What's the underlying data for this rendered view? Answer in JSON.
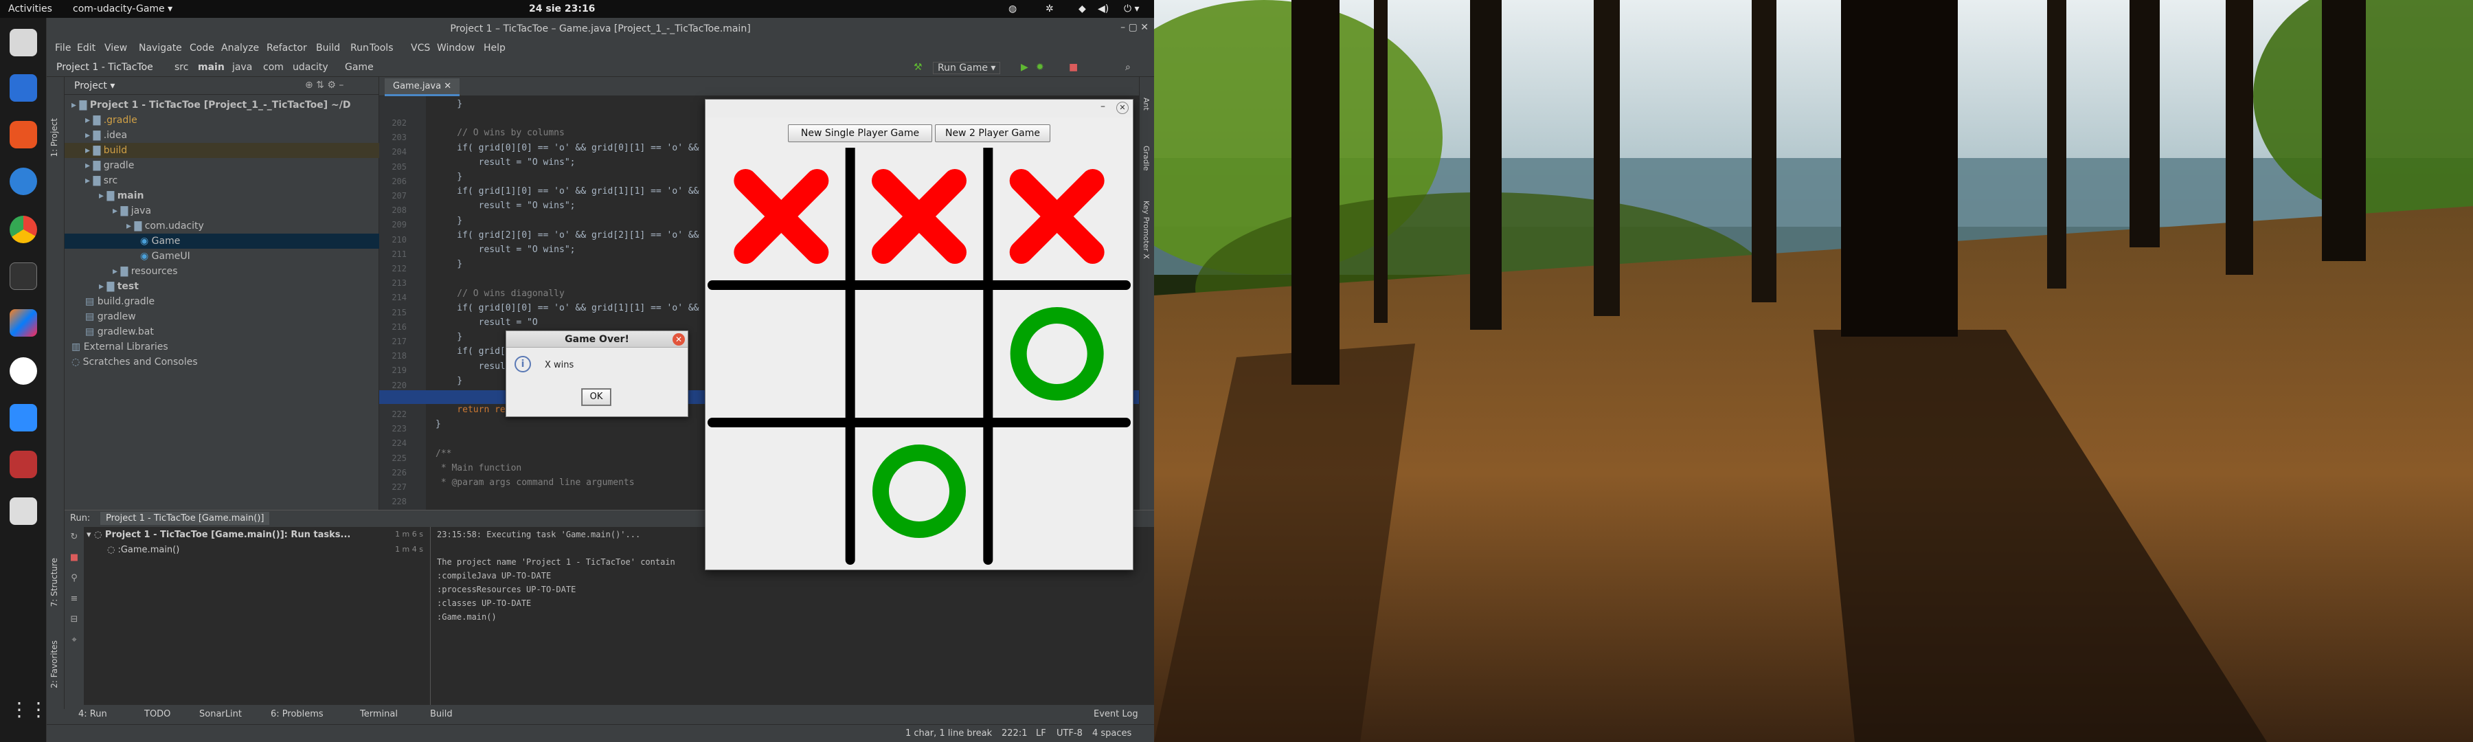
{
  "topbar": {
    "activities": "Activities",
    "app": "com-udacity-Game ▾",
    "datetime": "24 sie  23:16"
  },
  "ide": {
    "title": "Project 1 – TicTacToe – Game.java [Project_1_-_TicTacToe.main]",
    "menu": [
      "File",
      "Edit",
      "View",
      "Navigate",
      "Code",
      "Analyze",
      "Refactor",
      "Build",
      "Run",
      "Tools",
      "VCS",
      "Window",
      "Help"
    ],
    "breadcrumb": [
      "Project 1 - TicTacToe",
      "src",
      "main",
      "java",
      "com",
      "udacity",
      "Game"
    ],
    "run_config": "Run Game ▾",
    "project_panel": {
      "label": "Project ▾",
      "tree": [
        {
          "t": "Project 1 - TicTacToe [Project_1_-_TicTacToe] ~/D",
          "d": 0
        },
        {
          "t": ".gradle",
          "d": 1
        },
        {
          "t": ".idea",
          "d": 1
        },
        {
          "t": "build",
          "d": 1
        },
        {
          "t": "gradle",
          "d": 1
        },
        {
          "t": "src",
          "d": 1
        },
        {
          "t": "main",
          "d": 2
        },
        {
          "t": "java",
          "d": 3
        },
        {
          "t": "com.udacity",
          "d": 4
        },
        {
          "t": "Game",
          "d": 5
        },
        {
          "t": "GameUI",
          "d": 5
        },
        {
          "t": "resources",
          "d": 3
        },
        {
          "t": "test",
          "d": 2
        },
        {
          "t": "build.gradle",
          "d": 1
        },
        {
          "t": "gradlew",
          "d": 1
        },
        {
          "t": "gradlew.bat",
          "d": 1
        },
        {
          "t": "External Libraries",
          "d": 0
        },
        {
          "t": "Scratches and Consoles",
          "d": 0
        }
      ]
    },
    "editor_tab": "Game.java",
    "code_lines": [
      {
        "n": "202",
        "c": "    }"
      },
      {
        "n": "203",
        "c": ""
      },
      {
        "n": "204",
        "c": "    // O wins by columns"
      },
      {
        "n": "205",
        "c": "    if( grid[0][0] == 'o' && grid[0][1] == 'o' && grid[0"
      },
      {
        "n": "206",
        "c": "        result = \"O wins\";"
      },
      {
        "n": "207",
        "c": "    }"
      },
      {
        "n": "208",
        "c": "    if( grid[1][0] == 'o' && grid[1][1] == 'o' && grid[1"
      },
      {
        "n": "209",
        "c": "        result = \"O wins\";"
      },
      {
        "n": "210",
        "c": "    }"
      },
      {
        "n": "211",
        "c": "    if( grid[2][0] == 'o' && grid[2][1] == 'o' && grid[2"
      },
      {
        "n": "212",
        "c": "        result = \"O wins\";"
      },
      {
        "n": "213",
        "c": "    }"
      },
      {
        "n": "214",
        "c": ""
      },
      {
        "n": "215",
        "c": "    // O wins diagonally"
      },
      {
        "n": "216",
        "c": "    if( grid[0][0] == 'o' && grid[1][1] == 'o' && grid[2"
      },
      {
        "n": "217",
        "c": "        result = \"O"
      },
      {
        "n": "218",
        "c": "    }"
      },
      {
        "n": "219",
        "c": "    if( grid[2][0]"
      },
      {
        "n": "220",
        "c": "        result = \"O"
      },
      {
        "n": "221",
        "c": "    }"
      },
      {
        "n": "222",
        "c": ""
      },
      {
        "n": "223",
        "c": "    return result;"
      },
      {
        "n": "224",
        "c": "}"
      },
      {
        "n": "225",
        "c": ""
      },
      {
        "n": "226",
        "c": "/**"
      },
      {
        "n": "227",
        "c": " * Main function"
      },
      {
        "n": "228",
        "c": " * @param args command line arguments"
      }
    ],
    "run_panel": {
      "label": "Run:",
      "tab": "Project 1 - TicTacToe [Game.main()]",
      "tree": [
        {
          "t": "Project 1 - TicTacToe [Game.main()]: Run tasks...",
          "time": "1 m 6 s"
        },
        {
          "t": ":Game.main()",
          "time": "1 m 4 s"
        }
      ],
      "console": [
        "23:15:58: Executing task 'Game.main()'...",
        "",
        "The project name 'Project 1 - TicTacToe' contain",
        ":compileJava UP-TO-DATE",
        ":processResources UP-TO-DATE",
        ":classes UP-TO-DATE",
        ":Game.main()"
      ]
    },
    "bottom_tools": [
      "4: Run",
      "TODO",
      "SonarLint",
      "6: Problems",
      "Terminal",
      "Build"
    ],
    "event_log": "Event Log",
    "status": {
      "selection": "1 char, 1 line break",
      "position": "222:1",
      "line_sep": "LF",
      "encoding": "UTF-8",
      "indent": "4 spaces"
    },
    "left_strip": [
      "1: Project",
      "7: Structure",
      "2: Favorites"
    ],
    "right_strip": [
      "Ant",
      "Gradle",
      "Key Promoter X"
    ]
  },
  "dialog": {
    "title": "Game Over!",
    "message": "X wins",
    "ok": "OK"
  },
  "game": {
    "buttons": [
      "New Single Player Game",
      "New 2 Player Game"
    ],
    "board": [
      [
        "X",
        "X",
        "X"
      ],
      [
        "",
        "",
        "O"
      ],
      [
        "",
        "O",
        ""
      ]
    ],
    "x_color": "#ff0000",
    "o_color": "#00a300"
  }
}
